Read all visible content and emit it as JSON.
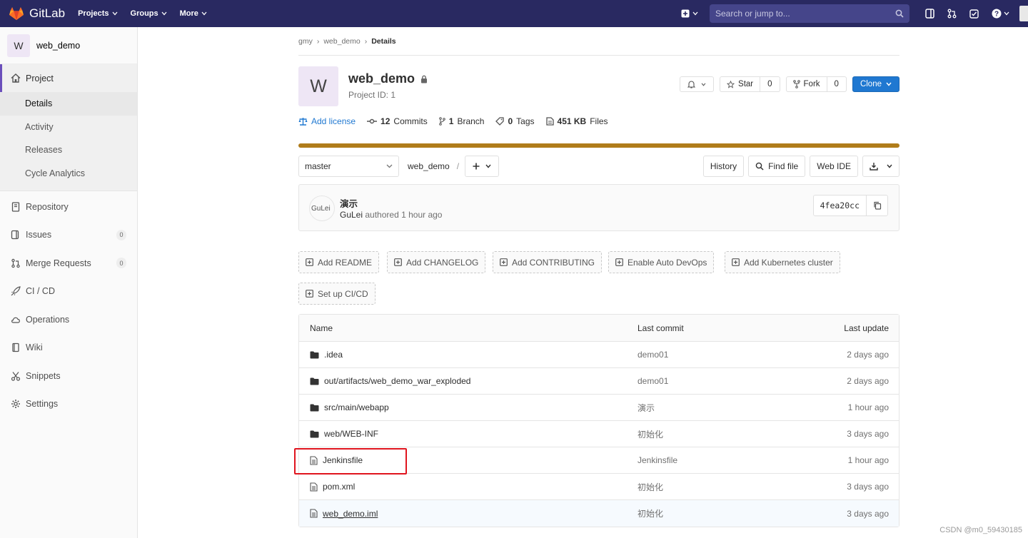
{
  "navbar": {
    "brand": "GitLab",
    "links": [
      "Projects",
      "Groups",
      "More"
    ],
    "search_placeholder": "Search or jump to..."
  },
  "sidebar": {
    "avatar_letter": "W",
    "project_name": "web_demo",
    "project_label": "Project",
    "project_subitems": [
      "Details",
      "Activity",
      "Releases",
      "Cycle Analytics"
    ],
    "items": [
      {
        "label": "Repository",
        "icon": "repository-icon"
      },
      {
        "label": "Issues",
        "icon": "issues-icon",
        "badge": "0"
      },
      {
        "label": "Merge Requests",
        "icon": "merge-request-icon",
        "badge": "0"
      },
      {
        "label": "CI / CD",
        "icon": "rocket-icon"
      },
      {
        "label": "Operations",
        "icon": "cloud-icon"
      },
      {
        "label": "Wiki",
        "icon": "book-icon"
      },
      {
        "label": "Snippets",
        "icon": "scissors-icon"
      },
      {
        "label": "Settings",
        "icon": "gear-icon"
      }
    ]
  },
  "breadcrumb": [
    "gmy",
    "web_demo",
    "Details"
  ],
  "project": {
    "avatar_letter": "W",
    "title": "web_demo",
    "id_text": "Project ID: 1",
    "star_label": "Star",
    "star_count": "0",
    "fork_label": "Fork",
    "fork_count": "0",
    "clone_label": "Clone"
  },
  "stats": {
    "add_license": "Add license",
    "commits_num": "12",
    "commits_label": "Commits",
    "branch_num": "1",
    "branch_label": "Branch",
    "tags_num": "0",
    "tags_label": "Tags",
    "files_num": "451 KB",
    "files_label": "Files"
  },
  "tree": {
    "branch": "master",
    "path": "web_demo",
    "separator": "/",
    "history": "History",
    "find_file": "Find file",
    "web_ide": "Web IDE"
  },
  "commit": {
    "avatar_alt": "GuLei",
    "title": "演示",
    "author": "GuLei",
    "meta": "authored 1 hour ago",
    "sha": "4fea20cc"
  },
  "quick_actions": [
    "Add README",
    "Add CHANGELOG",
    "Add CONTRIBUTING",
    "Enable Auto DevOps",
    "Add Kubernetes cluster",
    "Set up CI/CD"
  ],
  "files": {
    "headers": {
      "name": "Name",
      "commit": "Last commit",
      "update": "Last update"
    },
    "rows": [
      {
        "name": ".idea",
        "type": "folder",
        "commit": "demo01",
        "update": "2 days ago"
      },
      {
        "name": "out/artifacts/web_demo_war_exploded",
        "type": "folder",
        "commit": "demo01",
        "update": "2 days ago"
      },
      {
        "name": "src/main/webapp",
        "type": "folder",
        "commit": "演示",
        "update": "1 hour ago"
      },
      {
        "name": "web/WEB-INF",
        "type": "folder",
        "commit": "初始化",
        "update": "3 days ago"
      },
      {
        "name": "Jenkinsfile",
        "type": "file",
        "commit": "Jenkinsfile",
        "update": "1 hour ago"
      },
      {
        "name": "pom.xml",
        "type": "file",
        "commit": "初始化",
        "update": "3 days ago"
      },
      {
        "name": "web_demo.iml",
        "type": "file",
        "commit": "初始化",
        "update": "3 days ago"
      }
    ]
  },
  "watermark": "CSDN @m0_59430185",
  "colors": {
    "navbar": "#292961",
    "accent": "#1f78d1",
    "language_bar": "#b07c1a",
    "highlight": "#e0141e"
  }
}
